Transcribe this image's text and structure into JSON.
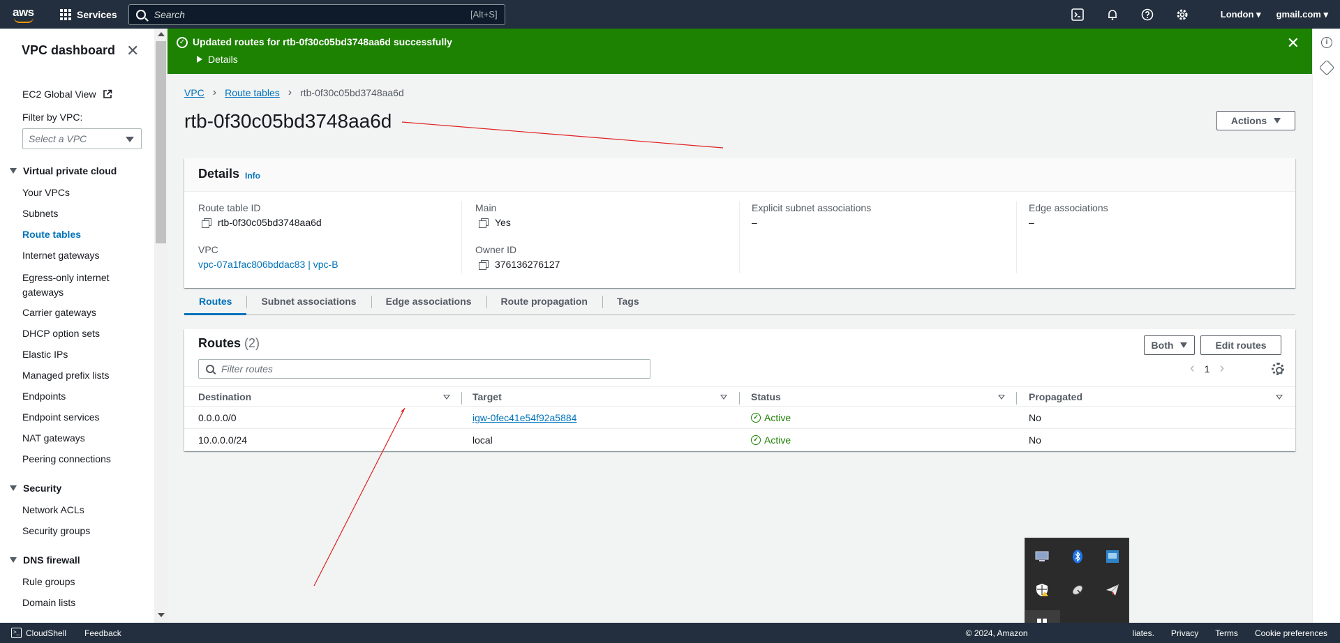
{
  "topnav": {
    "logo": "aws",
    "services_label": "Services",
    "search_placeholder": "Search",
    "search_hint": "[Alt+S]",
    "region": "London",
    "account": "gmail.com"
  },
  "sidenav": {
    "title": "VPC dashboard",
    "global_view": "EC2 Global View",
    "filter_label": "Filter by VPC:",
    "filter_placeholder": "Select a VPC",
    "sections": [
      {
        "label": "Virtual private cloud",
        "items": [
          "Your VPCs",
          "Subnets",
          "Route tables",
          "Internet gateways",
          "Egress-only internet gateways",
          "Carrier gateways",
          "DHCP option sets",
          "Elastic IPs",
          "Managed prefix lists",
          "Endpoints",
          "Endpoint services",
          "NAT gateways",
          "Peering connections"
        ]
      },
      {
        "label": "Security",
        "items": [
          "Network ACLs",
          "Security groups"
        ]
      },
      {
        "label": "DNS firewall",
        "items": [
          "Rule groups",
          "Domain lists"
        ]
      }
    ],
    "egress_line1": "Egress-only internet",
    "egress_line2": "gateways",
    "carrier_line1": "Carrier gateways"
  },
  "flash": {
    "message": "Updated routes for rtb-0f30c05bd3748aa6d successfully",
    "details_label": "Details"
  },
  "breadcrumb": [
    "VPC",
    "Route tables",
    "rtb-0f30c05bd3748aa6d"
  ],
  "page_title": "rtb-0f30c05bd3748aa6d",
  "actions_label": "Actions",
  "details": {
    "title": "Details",
    "info": "Info",
    "route_table_id_label": "Route table ID",
    "route_table_id": "rtb-0f30c05bd3748aa6d",
    "main_label": "Main",
    "main_value": "Yes",
    "explicit_label": "Explicit subnet associations",
    "explicit_value": "–",
    "edge_label": "Edge associations",
    "edge_value": "–",
    "vpc_label": "VPC",
    "vpc_value": "vpc-07a1fac806bddac83 | vpc-B",
    "owner_label": "Owner ID",
    "owner_value": "376136276127"
  },
  "tabs": [
    "Routes",
    "Subnet associations",
    "Edge associations",
    "Route propagation",
    "Tags"
  ],
  "routes": {
    "title": "Routes",
    "count": "(2)",
    "both_label": "Both",
    "edit_label": "Edit routes",
    "filter_placeholder": "Filter routes",
    "page": "1",
    "columns": [
      "Destination",
      "Target",
      "Status",
      "Propagated"
    ],
    "rows": [
      {
        "destination": "0.0.0.0/0",
        "target": "igw-0fec41e54f92a5884",
        "status": "Active",
        "propagated": "No"
      },
      {
        "destination": "10.0.0.0/24",
        "target": "local",
        "status": "Active",
        "propagated": "No"
      }
    ]
  },
  "footer": {
    "cloudshell": "CloudShell",
    "feedback": "Feedback",
    "copyright": "© 2024, Amazon",
    "affiliates": "liates.",
    "privacy": "Privacy",
    "terms": "Terms",
    "cookies": "Cookie preferences"
  },
  "colors": {
    "nav_bg": "#232f3e",
    "flash_bg": "#1d8102",
    "link": "#0073bb",
    "annotation": "#e02020"
  }
}
